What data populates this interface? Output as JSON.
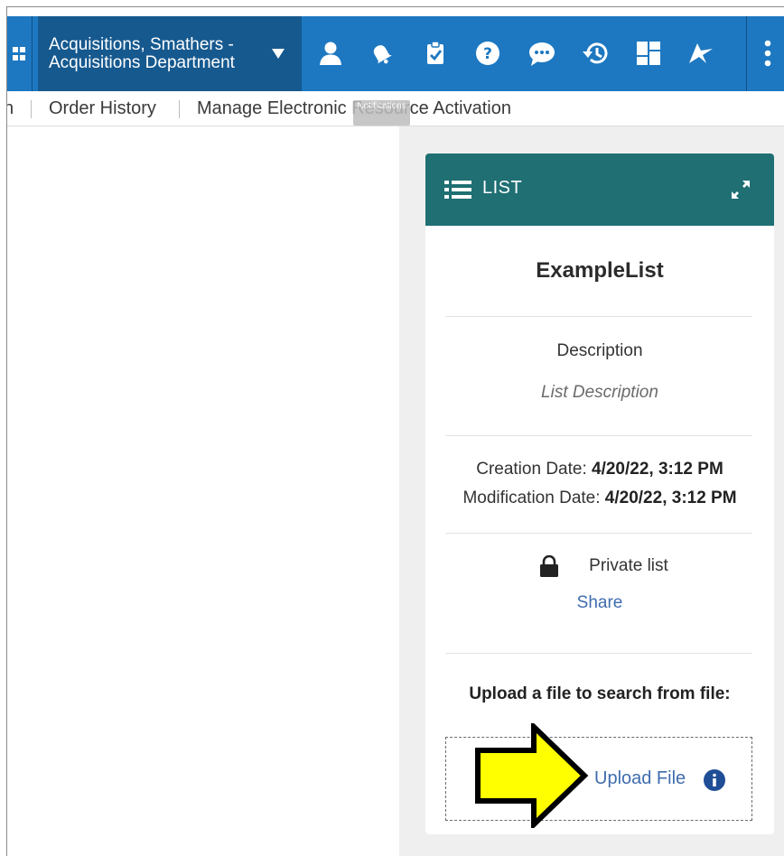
{
  "header": {
    "institution_line1": "Acquisitions, Smathers -",
    "institution_line2": "Acquisitions Department",
    "icons": [
      "grid-icon",
      "user-icon",
      "bell-icon",
      "tasks-icon",
      "help-icon",
      "chat-icon",
      "history-icon",
      "dashboard-icon",
      "plane-icon",
      "more-icon"
    ],
    "tooltip": "Notifications"
  },
  "subnav": {
    "items": [
      "Order History",
      "Manage Electronic Resource Activation"
    ]
  },
  "card": {
    "header_title": "LIST",
    "name": "ExampleList",
    "description_label": "Description",
    "description_value": "List Description",
    "creation_label": "Creation Date:",
    "creation_value": "4/20/22, 3:12 PM",
    "modification_label": "Modification Date:",
    "modification_value": "4/20/22, 3:12 PM",
    "privacy": "Private list",
    "share": "Share",
    "upload_prompt": "Upload a file to search from file:",
    "upload_link": "Upload File"
  },
  "colors": {
    "topbar": "#1d78c1",
    "institution_bg": "#16598f",
    "card_header": "#1f6f73",
    "link": "#3f6cae",
    "arrow_fill": "#ffff00"
  }
}
